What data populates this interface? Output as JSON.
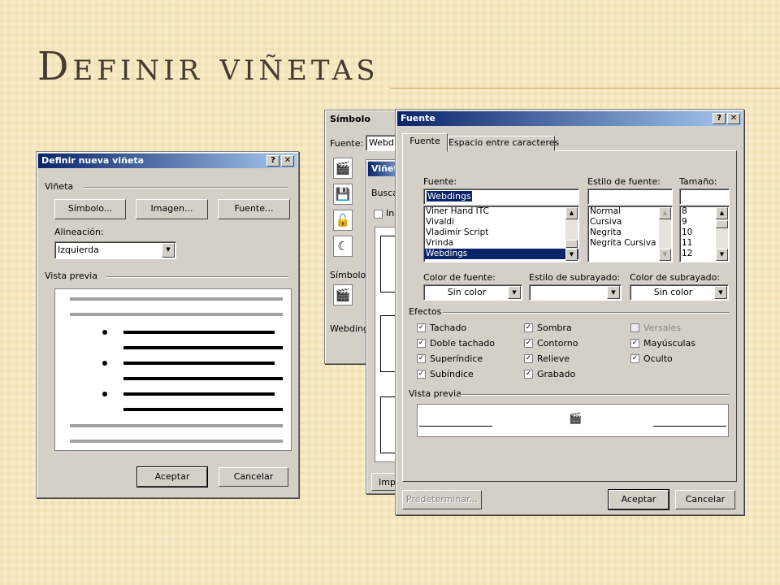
{
  "slide": {
    "title": "Definir viñetas"
  },
  "define_dialog": {
    "title": "Definir nueva viñeta",
    "help": "?",
    "close": "✕",
    "group_bullet": "Viñeta",
    "btn_symbol": "Símbolo...",
    "btn_image": "Imagen...",
    "btn_font": "Fuente...",
    "alignment_label": "Alineación:",
    "alignment_value": "Izquierda",
    "group_preview": "Vista previa",
    "ok": "Aceptar",
    "cancel": "Cancelar"
  },
  "symbol_dialog": {
    "title": "Símbolo",
    "font_label": "Fuente:",
    "font_value": "Webdin",
    "symbols_label": "Símbolos",
    "footer_text": "Webding",
    "cells": [
      "🎬",
      "💾",
      "🔓",
      "☾"
    ]
  },
  "image_dialog": {
    "title": "Viñeta",
    "search_label": "Buscar",
    "checkbox_label": "In",
    "import_label": "Imp"
  },
  "font_dialog": {
    "title": "Fuente",
    "help": "?",
    "close": "✕",
    "tabs": [
      {
        "label": "Fuente"
      },
      {
        "label": "Espacio entre caracteres"
      }
    ],
    "font_label": "Fuente:",
    "font_value": "Webdings",
    "font_list": [
      "Viner Hand ITC",
      "Vivaldi",
      "Vladimir Script",
      "Vrinda",
      "Webdings"
    ],
    "style_label": "Estilo de fuente:",
    "style_value": "",
    "style_list": [
      "Normal",
      "Cursiva",
      "Negrita",
      "Negrita Cursiva"
    ],
    "size_label": "Tamaño:",
    "size_value": "",
    "size_list": [
      "8",
      "9",
      "10",
      "11",
      "12"
    ],
    "color_label": "Color de fuente:",
    "color_value": "Sin color",
    "underline_style_label": "Estilo de subrayado:",
    "underline_style_value": "",
    "underline_color_label": "Color de subrayado:",
    "underline_color_value": "Sin color",
    "effects_label": "Efectos",
    "effects": {
      "tachado": "Tachado",
      "doble_tachado": "Doble tachado",
      "superindice": "Superíndice",
      "subindice": "Subíndice",
      "sombra": "Sombra",
      "contorno": "Contorno",
      "relieve": "Relieve",
      "grabado": "Grabado",
      "versales": "Versales",
      "mayusculas": "Mayúsculas",
      "oculto": "Oculto"
    },
    "preview_label": "Vista previa",
    "preview_glyph": "🎬",
    "default_btn": "Predeterminar...",
    "ok": "Aceptar",
    "cancel": "Cancelar"
  }
}
